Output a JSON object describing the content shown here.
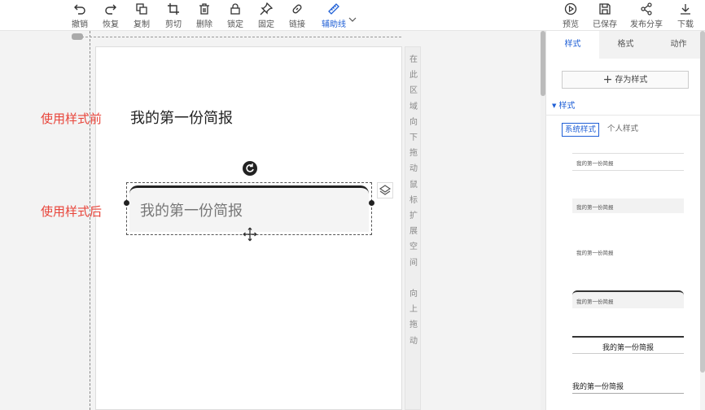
{
  "toolbar": {
    "undo": "撤销",
    "redo": "恢复",
    "copy": "复制",
    "crop": "剪切",
    "delete": "删除",
    "lock": "锁定",
    "pin": "固定",
    "link": "链接",
    "guides": "辅助线",
    "preview": "预览",
    "saved": "已保存",
    "share": "发布分享",
    "download": "下载"
  },
  "canvas": {
    "label_before": "使用样式前",
    "label_after": "使用样式后",
    "plain_title": "我的第一份简报",
    "styled_title": "我的第一份简报",
    "hint_chars": [
      "在",
      "此",
      "区",
      "域",
      "向",
      "下",
      "拖",
      "动",
      "鼠",
      "标",
      "扩",
      "展",
      "空",
      "间",
      "",
      "向",
      "上",
      "拖",
      "动"
    ]
  },
  "panel": {
    "tabs": [
      "样式",
      "格式",
      "动作"
    ],
    "save_style": "存为样式",
    "section_title": "样式",
    "subtabs": [
      "系统样式",
      "个人样式"
    ],
    "samples": [
      "我的第一份简报",
      "我的第一份简报",
      "我的第一份简报",
      "我的第一份简报",
      "我的第一份简报",
      "我的第一份简报"
    ]
  },
  "colors": {
    "accent": "#1f5fd6",
    "annotation_red": "#e8443a"
  }
}
